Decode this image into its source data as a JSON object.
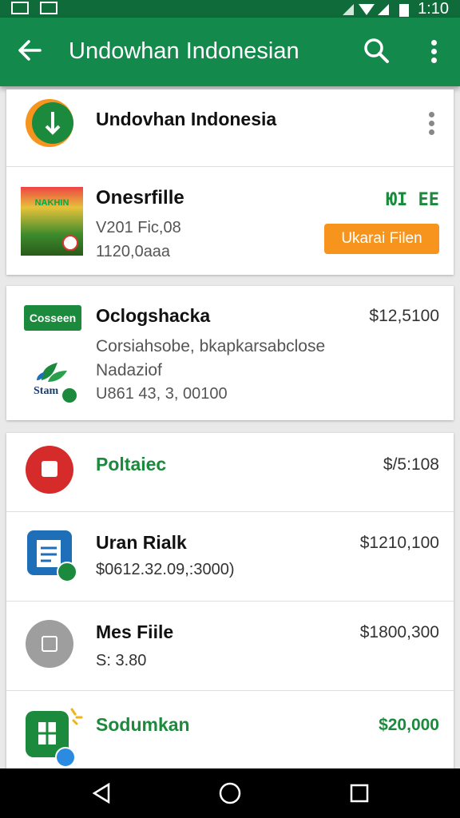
{
  "status": {
    "time": "1:10"
  },
  "appbar": {
    "title": "Undowhan Indonesian"
  },
  "header_app": {
    "name": "Undovhan Indonesia"
  },
  "featured": {
    "name": "Onesrfille",
    "line1": "V201 Fic,08",
    "line2": "1120,0aaa",
    "badge": "ЮІ ЕЕ",
    "button": "Ukarai Filen",
    "thumb_text": "NAKHIN"
  },
  "item_card": {
    "badge": "Cosseen",
    "small_label": "Stam",
    "name": "Oclogshacka",
    "price": "$12,5100",
    "desc1": "Corsiahsobe, bkapkarsabclose",
    "desc2": "Nadaziof",
    "desc3": "U861 43, 3, 00100"
  },
  "list": [
    {
      "name": "Poltaiec",
      "price": "$/5:108",
      "sub": ""
    },
    {
      "name": "Uran Rialk",
      "price": "$1210,100",
      "sub": "$0612.32.09,:3000)"
    },
    {
      "name": "Mes Fiile",
      "price": "$1800,300",
      "sub": "S: 3.80"
    },
    {
      "name": "Sodumkan",
      "price": "$20,000",
      "sub": ""
    }
  ],
  "colors": {
    "appbar": "#138a4b",
    "accent_orange": "#f7941d",
    "green_text": "#1b8a3c",
    "red_icon": "#d62b2b",
    "blue_icon": "#1f6fb8"
  }
}
